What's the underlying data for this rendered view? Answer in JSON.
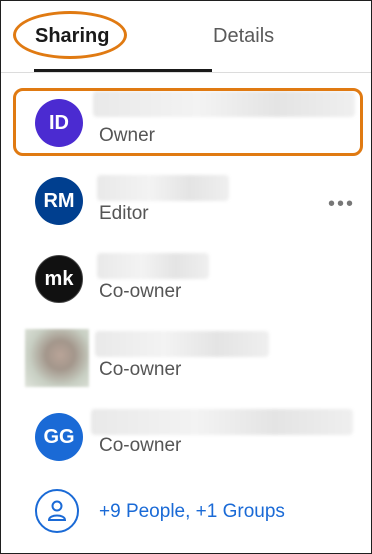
{
  "tabs": [
    {
      "label": "Sharing",
      "active": true
    },
    {
      "label": "Details",
      "active": false
    }
  ],
  "people": [
    {
      "initials": "ID",
      "role": "Owner",
      "avatar_color": "#4b2bd1"
    },
    {
      "initials": "RM",
      "role": "Editor",
      "avatar_color": "#003f8f"
    },
    {
      "initials": "mk",
      "role": "Co-owner",
      "avatar_color": "#111111"
    },
    {
      "initials": "",
      "role": "Co-owner",
      "avatar_color": ""
    },
    {
      "initials": "GG",
      "role": "Co-owner",
      "avatar_color": "#1a6ad6"
    }
  ],
  "more_actions_label": "•••",
  "add_people": {
    "label": "+9 People, +1 Groups",
    "icon": "person-icon"
  },
  "accent": "#e07a12",
  "link_color": "#1a6ad6"
}
